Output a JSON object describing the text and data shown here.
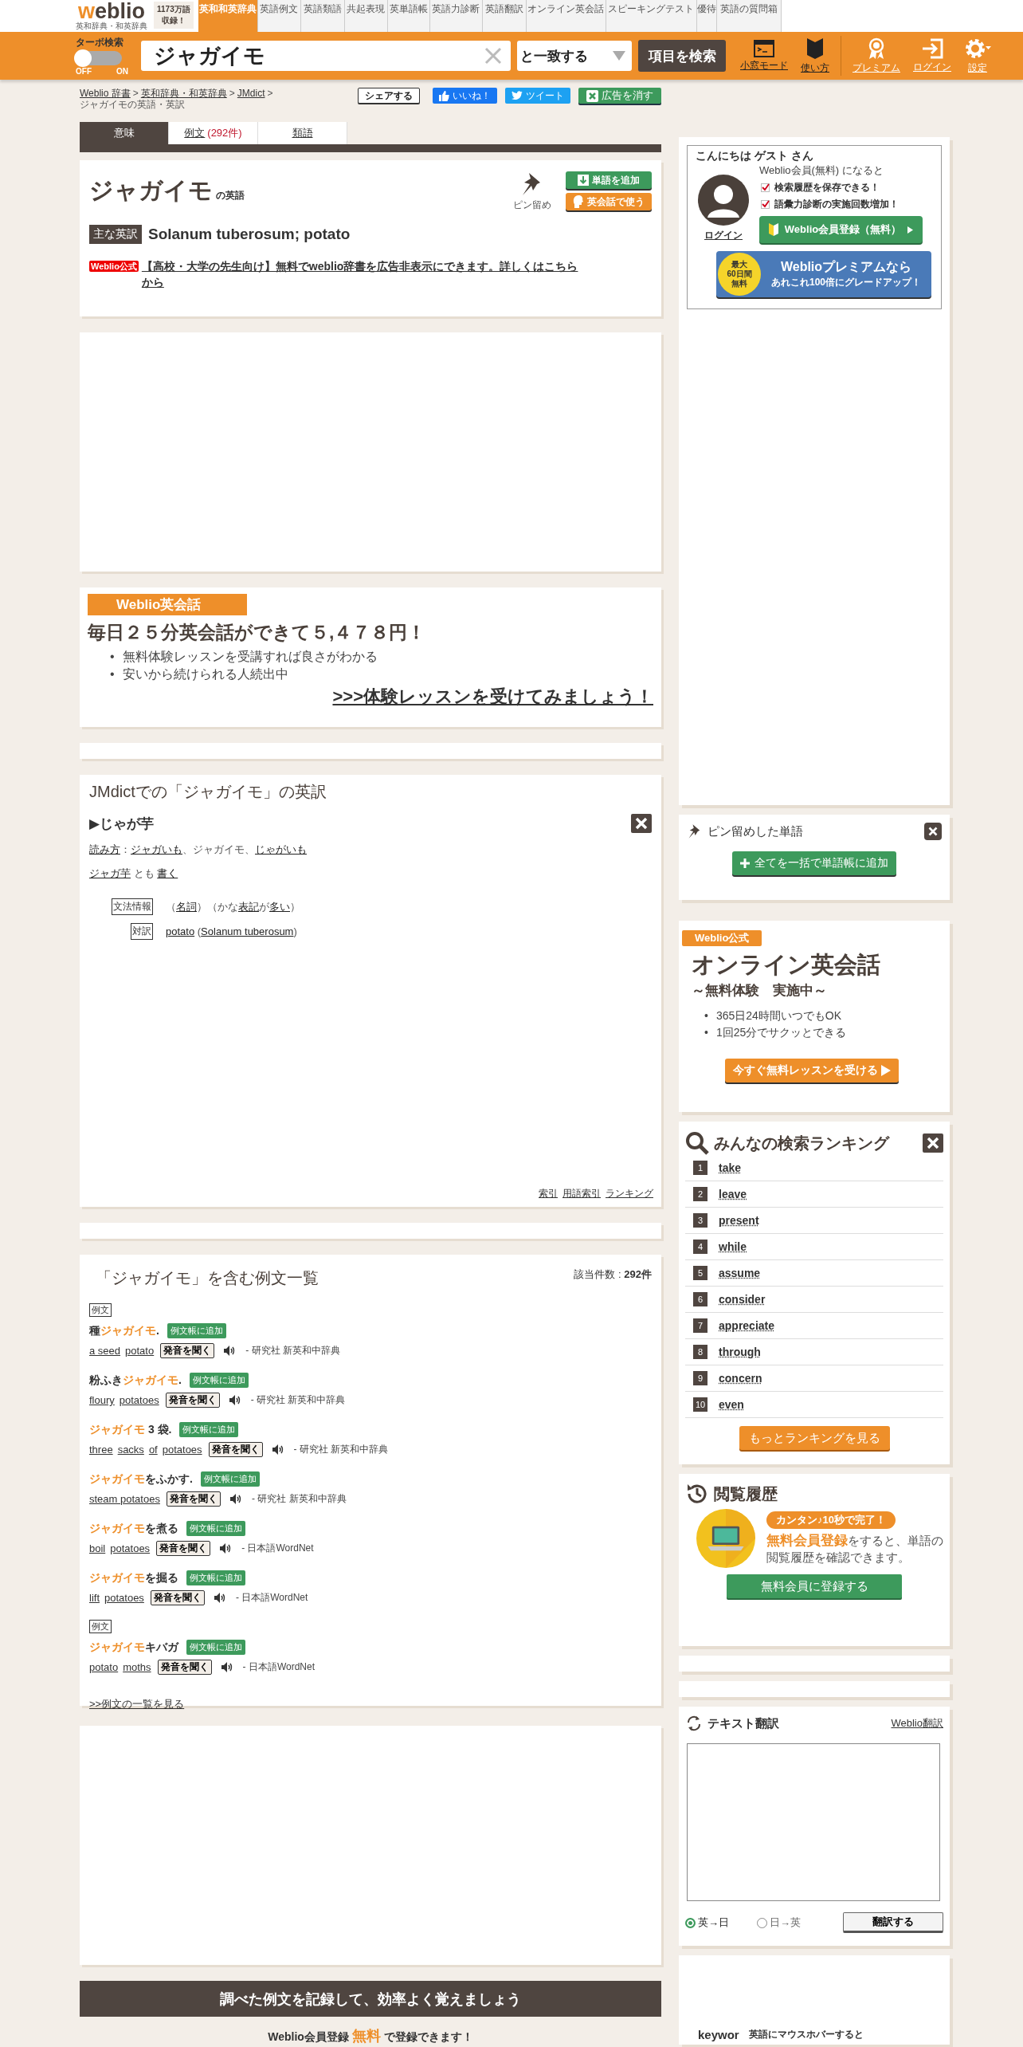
{
  "header": {
    "logo": "weblio",
    "logo_sub": "英和辞典・和英辞典",
    "count_badge": [
      "1173万語",
      "収録！"
    ],
    "nav_tabs": [
      {
        "label": "英和和英辞典",
        "selected": true
      },
      {
        "label": "英語例文",
        "selected": false
      },
      {
        "label": "英語類語",
        "selected": false
      },
      {
        "label": "共起表現",
        "selected": false
      },
      {
        "label": "英単語帳",
        "selected": false
      },
      {
        "label": "英語力診断",
        "selected": false
      },
      {
        "label": "英語翻訳",
        "selected": false
      },
      {
        "label": "オンライン英会話",
        "selected": false
      },
      {
        "label": "スピーキングテスト",
        "selected": false
      },
      {
        "label": "優待",
        "selected": false
      },
      {
        "label": "英語の質問箱",
        "selected": false
      }
    ],
    "turbo": {
      "label": "ターボ検索",
      "off_label": "OFF",
      "on_label": "ON",
      "on": false
    },
    "search": {
      "value": "ジャガイモ",
      "match_select": "と一致する",
      "button": "項目を検索"
    },
    "tools": [
      {
        "kind": "window",
        "label": "小窓モード"
      },
      {
        "kind": "guide",
        "label": "使い方"
      },
      {
        "kind": "premium",
        "label": "プレミアム"
      },
      {
        "kind": "login",
        "label": "ログイン"
      },
      {
        "kind": "settings",
        "label": "設定"
      }
    ]
  },
  "breadcrumb": {
    "links": [
      {
        "text": "Weblio 辞書",
        "separator": ">"
      },
      {
        "text": "英和辞典・和英辞典",
        "separator": ">"
      },
      {
        "text": "JMdict",
        "separator": ">"
      }
    ],
    "current": "ジャガイモの英語・英訳"
  },
  "share_buttons": [
    {
      "kind": "share",
      "label": "シェアする"
    },
    {
      "kind": "like",
      "label": "いいね！"
    },
    {
      "kind": "tweet",
      "label": "ツイート"
    },
    {
      "kind": "noads",
      "label": "広告を消す"
    }
  ],
  "tabs": [
    {
      "label": "意味",
      "selected": true
    },
    {
      "label": "例文",
      "count": "(292件)",
      "selected": false
    },
    {
      "label": "類語",
      "selected": false
    }
  ],
  "word_card": {
    "title": "ジャガイモ",
    "suffix": "の英語",
    "pin_label": "ピン留め",
    "add_button": "単語を追加",
    "conversation_button": "英会話で使う",
    "main_label": "主な英訳",
    "main_translation": "Solanum tuberosum; potato",
    "promo_badge": "Weblio公式",
    "promo_link": "【高校・大学の先生向け】無料でweblio辞書を広告非表示にできます。詳しくはこちらから"
  },
  "eikaiwa_ad": {
    "label": "Weblio英会話",
    "headline": "毎日２５分英会話ができて５,４７８円！",
    "bullets": [
      {
        "marker": "•",
        "text": "無料体験レッスンを受講すれば良さがわかる"
      },
      {
        "marker": "•",
        "text": "安いから続けられる人続出中"
      }
    ],
    "cta": ">>>体験レッスンを受けてみましょう！"
  },
  "jmdict": {
    "title": "JMdictでの「ジャガイモ」の英訳",
    "entry": "▶じゃが芋",
    "reading": [
      {
        "text": "読み方",
        "link": true
      },
      {
        "text": "：",
        "link": false
      },
      {
        "text": "ジャガいも",
        "link": true
      },
      {
        "text": "、ジャガイモ、",
        "link": false
      },
      {
        "text": "じゃがいも",
        "link": true
      }
    ],
    "also": [
      {
        "text": "ジャガ芋",
        "link": true
      },
      {
        "text": " とも ",
        "link": false
      },
      {
        "text": "書く",
        "link": true
      }
    ],
    "grammar_label": "文法情報",
    "grammar": [
      {
        "text": "（",
        "link": false
      },
      {
        "text": "名詞",
        "link": true
      },
      {
        "text": "）（かな",
        "link": false
      },
      {
        "text": "表記",
        "link": true
      },
      {
        "text": "が",
        "link": false
      },
      {
        "text": "多い",
        "link": true
      },
      {
        "text": "）",
        "link": false
      }
    ],
    "translation_label": "対訳",
    "translation": [
      {
        "text": "potato",
        "link": true
      },
      {
        "text": " (",
        "link": false
      },
      {
        "text": "Solanum tuberosum",
        "link": true
      },
      {
        "text": ")",
        "link": false
      }
    ],
    "footer_links": [
      "索引",
      "用語索引",
      "ランキング"
    ]
  },
  "examples": {
    "title": "「ジャガイモ」を含む例文一覧",
    "count_label": "該当件数 : ",
    "count": "292件",
    "items": [
      {
        "tag": "例文",
        "pre": "種",
        "hit": "ジャガイモ",
        "post": ".",
        "add_button": "例文帳に追加",
        "en": [
          "a seed",
          "potato"
        ],
        "listen_button": "発音を聞く",
        "source": "- 研究社 新英和中辞典"
      },
      {
        "pre": "粉ふき",
        "hit": "ジャガイモ",
        "post": ".",
        "add_button": "例文帳に追加",
        "en": [
          "floury",
          "potatoes"
        ],
        "listen_button": "発音を聞く",
        "source": "- 研究社 新英和中辞典"
      },
      {
        "hit": "ジャガイモ",
        "post": " 3 袋.",
        "add_button": "例文帳に追加",
        "en": [
          "three",
          "sacks",
          "of",
          "potatoes"
        ],
        "listen_button": "発音を聞く",
        "source": "- 研究社 新英和中辞典"
      },
      {
        "hit": "ジャガイモ",
        "post": "をふかす.",
        "add_button": "例文帳に追加",
        "en": [
          "steam potatoes"
        ],
        "listen_button": "発音を聞く",
        "source": "- 研究社 新英和中辞典"
      },
      {
        "hit": "ジャガイモ",
        "post": "を煮る",
        "add_button": "例文帳に追加",
        "en": [
          "boil",
          "potatoes"
        ],
        "listen_button": "発音を聞く",
        "source": "- 日本語WordNet"
      },
      {
        "hit": "ジャガイモ",
        "post": "を掘る",
        "add_button": "例文帳に追加",
        "en": [
          "lift",
          "potatoes"
        ],
        "listen_button": "発音を聞く",
        "source": "- 日本語WordNet"
      },
      {
        "tag": "例文",
        "hit": "ジャガイモ",
        "post": "キバガ",
        "add_button": "例文帳に追加",
        "en": [
          "potato",
          "moths"
        ],
        "listen_button": "発音を聞く",
        "source": "- 日本語WordNet"
      }
    ],
    "more_link": ">>例文の一覧を見る"
  },
  "banner": {
    "title": "調べた例文を記録して、効率よく覚えましょう",
    "pre": "Weblio会員登録 ",
    "em": "無料",
    "post": " で登録できます！"
  },
  "login_panel": {
    "greeting": "こんにちは ゲスト さん",
    "login_link": "ログイン",
    "lead": "Weblio会員(無料) になると",
    "benefits": [
      "検索履歴を保存できる！",
      "語彙力診断の実施回数増加！"
    ],
    "register_button": "Weblio会員登録（無料）",
    "premium": {
      "badge": [
        "最大",
        "60日間",
        "無料"
      ],
      "line1": "Weblioプレミアムなら",
      "line2": "あれこれ100倍にグレードアップ！"
    }
  },
  "pin_panel": {
    "title": "ピン留めした単語",
    "button": "全てを一括で単語帳に追加"
  },
  "online_ad": {
    "badge": "Weblio公式",
    "title": "オンライン英会話",
    "subtitle": "～無料体験　実施中～",
    "bullets": [
      {
        "marker": "•",
        "text": "365日24時間いつでもOK"
      },
      {
        "marker": "•",
        "text": "1回25分でサクッとできる"
      }
    ],
    "cta": "今すぐ無料レッスンを受ける"
  },
  "ranking": {
    "title": "みんなの検索ランキング",
    "items": [
      {
        "rank": "1",
        "word": "take"
      },
      {
        "rank": "2",
        "word": "leave"
      },
      {
        "rank": "3",
        "word": "present"
      },
      {
        "rank": "4",
        "word": "while"
      },
      {
        "rank": "5",
        "word": "assume"
      },
      {
        "rank": "6",
        "word": "consider"
      },
      {
        "rank": "7",
        "word": "appreciate"
      },
      {
        "rank": "8",
        "word": "through"
      },
      {
        "rank": "9",
        "word": "concern"
      },
      {
        "rank": "10",
        "word": "even"
      }
    ],
    "more_button": "もっとランキングを見る"
  },
  "history": {
    "title": "閲覧履歴",
    "bubble": "カンタン♪10秒で完了！",
    "em": "無料会員登録",
    "text": "をすると、単語の閲覧履歴を確認できます。",
    "button": "無料会員に登録する"
  },
  "translate": {
    "title": "テキスト翻訳",
    "link": "Weblio翻訳",
    "directions": [
      {
        "label": "英→日",
        "selected": true
      },
      {
        "label": "日→英",
        "selected": false
      }
    ],
    "button": "翻訳する"
  },
  "hover_promo": {
    "keyword": "keywor",
    "text": "英語にマウスホバーすると"
  }
}
